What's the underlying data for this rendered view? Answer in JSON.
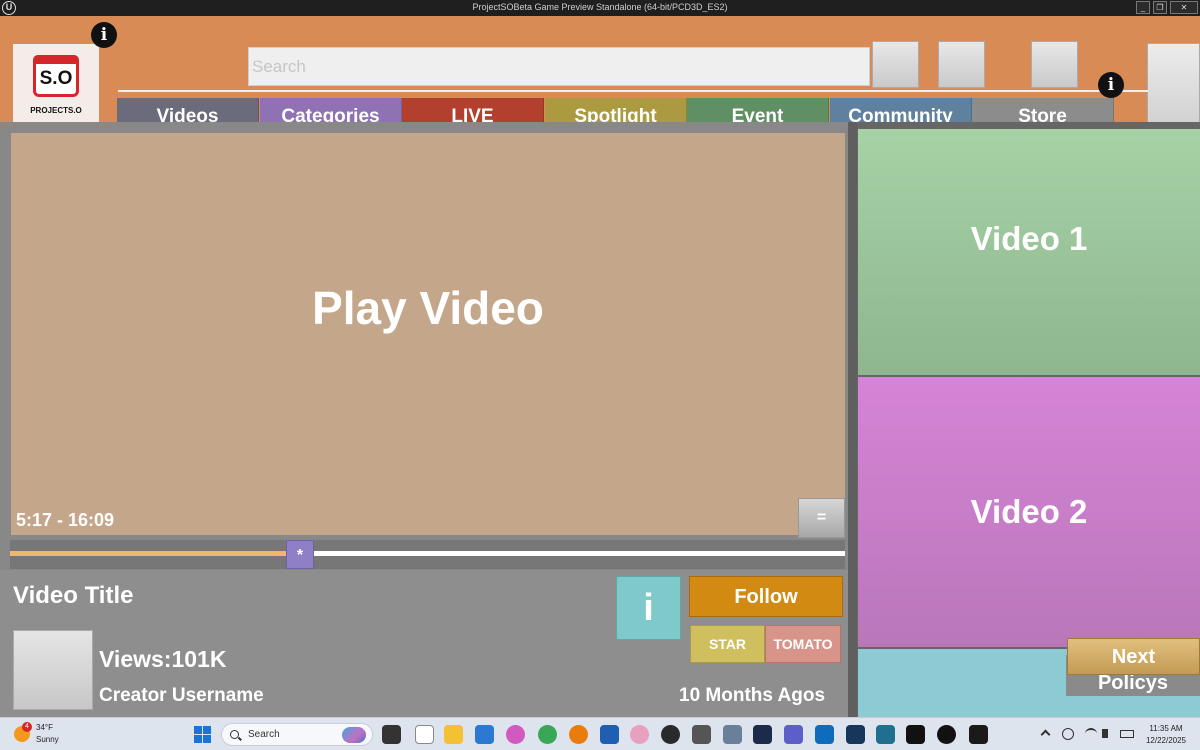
{
  "window": {
    "title": "ProjectSOBeta Game Preview Standalone (64-bit/PCD3D_ES2)",
    "controls": [
      "minimize",
      "restore",
      "close"
    ]
  },
  "header": {
    "logo_mark": "S.O",
    "logo_text": "PROJECTS.O",
    "search_placeholder": "Search"
  },
  "tabs": [
    {
      "label": "Videos",
      "color": "#6b6b7b"
    },
    {
      "label": "Categories",
      "color": "#8f72b3"
    },
    {
      "label": "LIVE",
      "color": "#b3402f"
    },
    {
      "label": "Spotlight",
      "color": "#ab9a3f"
    },
    {
      "label": "Event",
      "color": "#5f8f63"
    },
    {
      "label": "Community",
      "color": "#5f809f"
    },
    {
      "label": "Store",
      "color": "#8c8c8c"
    }
  ],
  "player": {
    "label": "Play Video",
    "timecode": "5:17 - 16:09",
    "menu_label": "=",
    "progress": 0.33,
    "thumb_label": "*"
  },
  "video": {
    "title": "Video Title",
    "views": "Views:101K",
    "creator": "Creator Username",
    "posted": "10 Months Agos",
    "info_label": "i",
    "follow_label": "Follow",
    "star_label": "STAR",
    "tomato_label": "TOMATO"
  },
  "sidebar": {
    "video1": "Video 1",
    "video2": "Video 2",
    "policys": "Policys",
    "next": "Next"
  },
  "colors": {
    "header": "#d98b55",
    "player": "#c4a68a",
    "seek_fill": "#f0b66d",
    "follow": "#d28a12"
  },
  "taskbar": {
    "temperature": "34°F",
    "condition": "Sunny",
    "weather_badge": "4",
    "search_label": "Search",
    "time": "11:35 AM",
    "date": "12/22/2025"
  }
}
